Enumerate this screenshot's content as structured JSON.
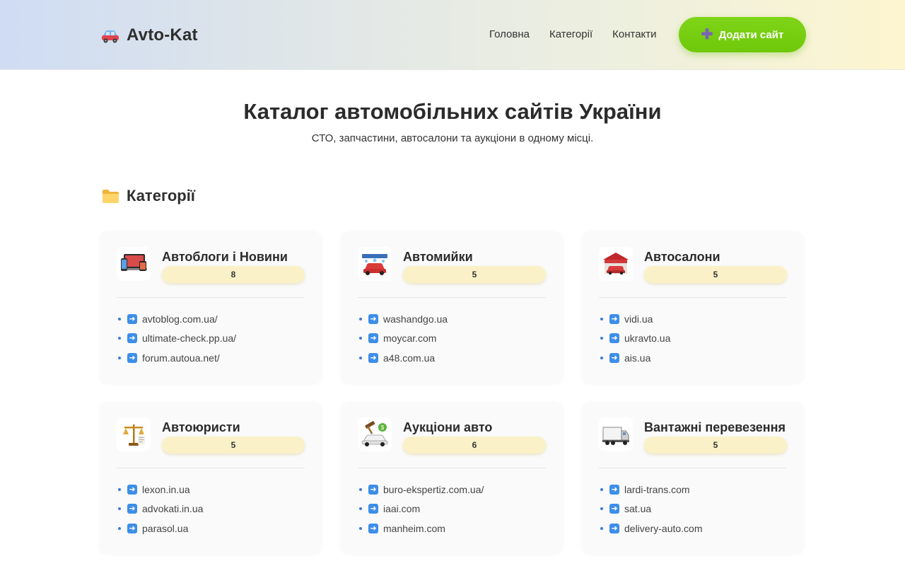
{
  "header": {
    "brand": "Avto-Kat",
    "brand_icon": "car-icon",
    "nav": [
      "Головна",
      "Категорії",
      "Контакти"
    ],
    "add_button": "Додати сайт",
    "colors": {
      "accent": "#76cf10",
      "plus": "#7b63b7"
    }
  },
  "hero": {
    "title": "Каталог автомобільних сайтів України",
    "subtitle": "СТО, запчастини, автосалони та аукціони в одному місці."
  },
  "categories_section": {
    "title": "Категорії",
    "icon": "folder-icon",
    "cards": [
      {
        "title": "Автоблоги і Новини",
        "count": "8",
        "icon": "devices-icon",
        "links": [
          "avtoblog.com.ua/",
          "ultimate-check.pp.ua/",
          "forum.autoua.net/"
        ]
      },
      {
        "title": "Автомийки",
        "count": "5",
        "icon": "car-wash-icon",
        "links": [
          "washandgo.ua",
          "moycar.com",
          "a48.com.ua"
        ]
      },
      {
        "title": "Автосалони",
        "count": "5",
        "icon": "car-dealer-icon",
        "links": [
          "vidi.ua",
          "ukravto.ua",
          "ais.ua"
        ]
      },
      {
        "title": "Автоюристи",
        "count": "5",
        "icon": "law-scales-icon",
        "links": [
          "lexon.in.ua",
          "advokati.in.ua",
          "parasol.ua"
        ]
      },
      {
        "title": "Аукціони авто",
        "count": "6",
        "icon": "auction-car-icon",
        "links": [
          "buro-ekspertiz.com.ua/",
          "iaai.com",
          "manheim.com"
        ]
      },
      {
        "title": "Вантажні перевезення",
        "count": "5",
        "icon": "truck-icon",
        "links": [
          "lardi-trans.com",
          "sat.ua",
          "delivery-auto.com"
        ]
      }
    ]
  }
}
